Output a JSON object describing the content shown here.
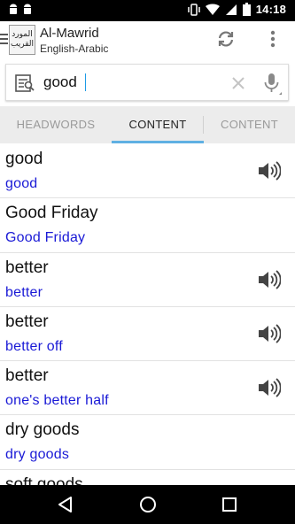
{
  "status_bar": {
    "time": "14:18",
    "icons": [
      "android-icon",
      "android-icon",
      "vibrate-icon",
      "wifi-icon",
      "signal-icon",
      "battery-icon"
    ]
  },
  "app_bar": {
    "logo_text": "المورد القريب",
    "title": "Al-Mawrid",
    "subtitle": "English-Arabic",
    "icons": [
      "menu-icon",
      "sync-icon",
      "overflow-menu-icon"
    ]
  },
  "search": {
    "value": "good",
    "icons": [
      "search-type-icon",
      "clear-icon",
      "microphone-icon"
    ]
  },
  "tabs": [
    {
      "label": "HEADWORDS",
      "active": false
    },
    {
      "label": "CONTENT",
      "active": true
    },
    {
      "label": "CONTENT",
      "active": false
    }
  ],
  "colors": {
    "translation_text": "#1a1ad6",
    "tab_indicator": "#5fb0e3",
    "tab_background": "#ececec"
  },
  "results": [
    {
      "headword": "good",
      "translation": "good",
      "speaker": true
    },
    {
      "headword": "Good Friday",
      "translation": "Good Friday",
      "speaker": false
    },
    {
      "headword": "better",
      "translation": "better",
      "speaker": true
    },
    {
      "headword": "better",
      "translation": "better off",
      "speaker": true
    },
    {
      "headword": "better",
      "translation": "one's better half",
      "speaker": true
    },
    {
      "headword": "dry goods",
      "translation": "dry goods",
      "speaker": false
    },
    {
      "headword": "soft goods",
      "translation": "",
      "speaker": false
    }
  ],
  "nav_bar": {
    "icons": [
      "back-icon",
      "home-icon",
      "recents-icon"
    ]
  }
}
